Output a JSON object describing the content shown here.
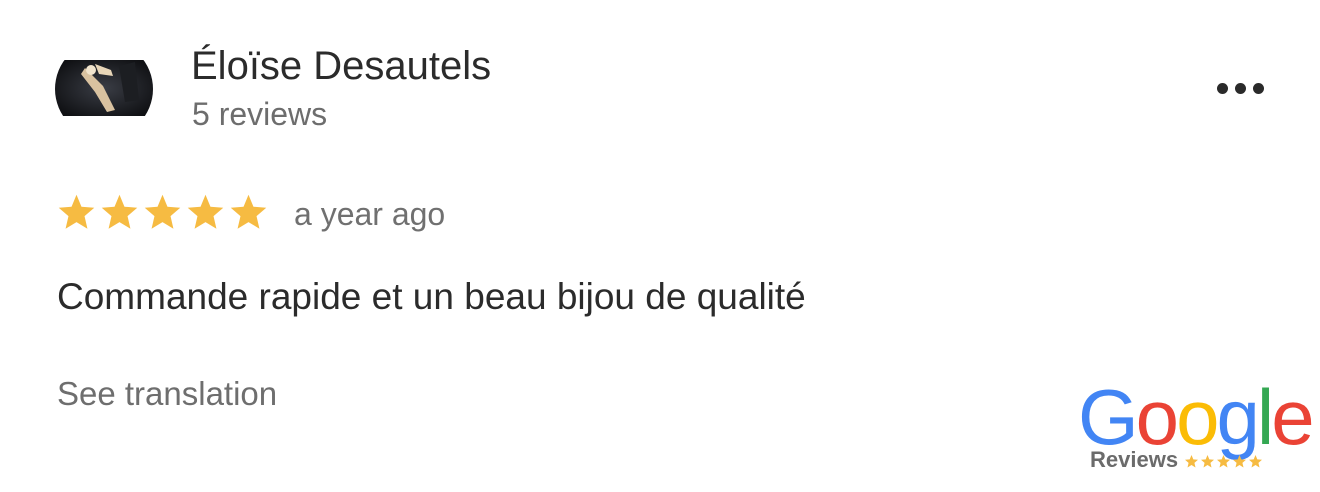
{
  "reviewer": {
    "name": "Éloïse Desautels",
    "review_count": "5 reviews"
  },
  "review": {
    "rating": 5,
    "max_rating": 5,
    "time": "a year ago",
    "text": "Commande rapide et un beau bijou de qualité",
    "translate_label": "See translation"
  },
  "badge": {
    "brand_letters": [
      "G",
      "o",
      "o",
      "g",
      "l",
      "e"
    ],
    "brand_colors": [
      "#4285F4",
      "#EA4335",
      "#FBBC05",
      "#4285F4",
      "#34A853",
      "#EA4335"
    ],
    "label": "Reviews",
    "stars": 5
  },
  "icons": {
    "menu": "more-horiz-icon",
    "star": "star-icon"
  },
  "colors": {
    "star": "#F6BB42",
    "text_primary": "#2b2b2b",
    "text_secondary": "#6d6d6d"
  }
}
